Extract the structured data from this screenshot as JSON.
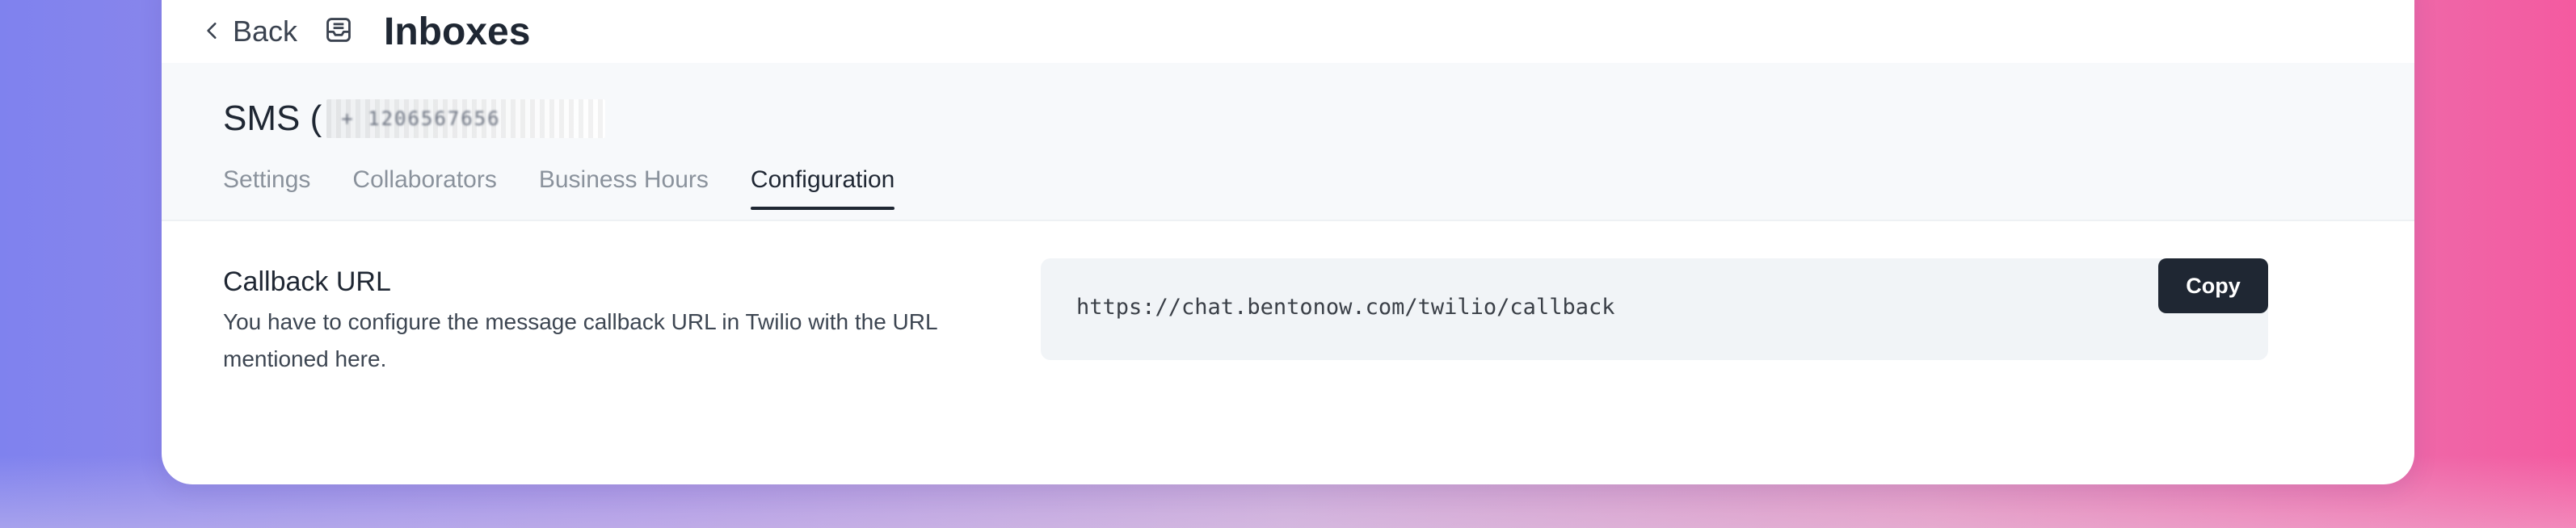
{
  "topbar": {
    "back_label": "Back",
    "title": "Inboxes"
  },
  "header": {
    "inbox_name": "SMS (",
    "phone_redacted": "+ 1206567656"
  },
  "tabs": [
    {
      "label": "Settings",
      "active": false
    },
    {
      "label": "Collaborators",
      "active": false
    },
    {
      "label": "Business Hours",
      "active": false
    },
    {
      "label": "Configuration",
      "active": true
    }
  ],
  "callback": {
    "title": "Callback URL",
    "description": "You have to configure the message callback URL in Twilio with the URL mentioned here.",
    "url": "https://chat.bentonow.com/twilio/callback",
    "copy_label": "Copy"
  },
  "icons": {
    "back": "chevron-left-icon",
    "inbox": "inbox-icon"
  }
}
